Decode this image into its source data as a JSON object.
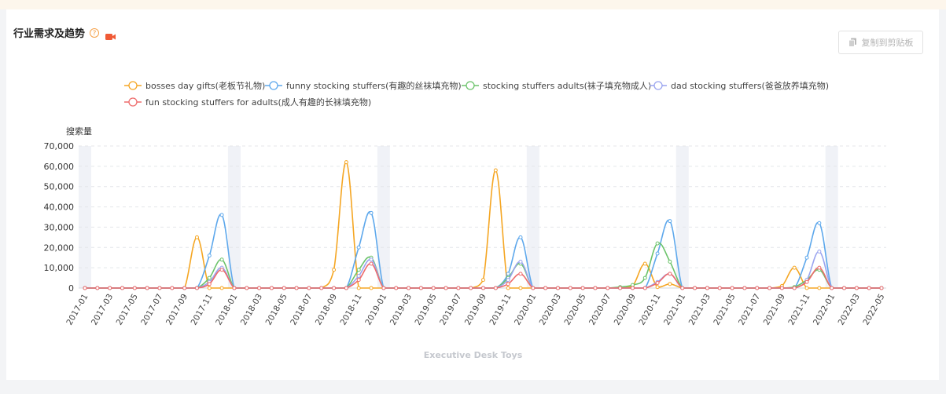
{
  "header": {
    "title": "行业需求及趋势",
    "help_glyph": "?",
    "copy_label": "复制到剪贴板"
  },
  "colors": {
    "accent": "#f08a3a",
    "video_icon": "#f05a36"
  },
  "chart_data": {
    "type": "line",
    "ylabel": "搜索量",
    "xlabel": "",
    "ylim": [
      0,
      70000
    ],
    "yticks": [
      "0",
      "10,000",
      "20,000",
      "30,000",
      "40,000",
      "50,000",
      "60,000",
      "70,000"
    ],
    "x": [
      "2017-01",
      "2017-02",
      "2017-03",
      "2017-04",
      "2017-05",
      "2017-06",
      "2017-07",
      "2017-08",
      "2017-09",
      "2017-10",
      "2017-11",
      "2017-12",
      "2018-01",
      "2018-02",
      "2018-03",
      "2018-04",
      "2018-05",
      "2018-06",
      "2018-07",
      "2018-08",
      "2018-09",
      "2018-10",
      "2018-11",
      "2018-12",
      "2019-01",
      "2019-02",
      "2019-03",
      "2019-04",
      "2019-05",
      "2019-06",
      "2019-07",
      "2019-08",
      "2019-09",
      "2019-10",
      "2019-11",
      "2019-12",
      "2020-01",
      "2020-02",
      "2020-03",
      "2020-04",
      "2020-05",
      "2020-06",
      "2020-07",
      "2020-08",
      "2020-09",
      "2020-10",
      "2020-11",
      "2020-12",
      "2021-01",
      "2021-02",
      "2021-03",
      "2021-04",
      "2021-05",
      "2021-06",
      "2021-07",
      "2021-08",
      "2021-09",
      "2021-10",
      "2021-11",
      "2021-12",
      "2022-01",
      "2022-02",
      "2022-03",
      "2022-04",
      "2022-05"
    ],
    "xticks": [
      "2017-01",
      "2017-03",
      "2017-05",
      "2017-07",
      "2017-09",
      "2017-11",
      "2018-01",
      "2018-03",
      "2018-05",
      "2018-07",
      "2018-09",
      "2018-11",
      "2019-01",
      "2019-03",
      "2019-05",
      "2019-07",
      "2019-09",
      "2019-11",
      "2020-01",
      "2020-03",
      "2020-05",
      "2020-07",
      "2020-09",
      "2020-11",
      "2021-01",
      "2021-03",
      "2021-05",
      "2021-07",
      "2021-09",
      "2021-11",
      "2022-01",
      "2022-03",
      "2022-05"
    ],
    "series": [
      {
        "name": "bosses day gifts(老板节礼物)",
        "color": "#f5a623",
        "values": [
          0,
          0,
          0,
          0,
          0,
          0,
          0,
          0,
          0,
          25000,
          0,
          0,
          0,
          0,
          0,
          0,
          0,
          0,
          0,
          0,
          9000,
          62000,
          0,
          0,
          0,
          0,
          0,
          0,
          0,
          0,
          0,
          0,
          4000,
          58000,
          0,
          0,
          0,
          0,
          0,
          0,
          0,
          0,
          0,
          0,
          1000,
          12000,
          500,
          2000,
          0,
          0,
          0,
          0,
          0,
          0,
          0,
          0,
          1000,
          10000,
          0,
          0,
          0,
          0,
          0,
          0,
          0
        ]
      },
      {
        "name": "funny stocking stuffers(有趣的丝袜填充物)",
        "color": "#5ea8ec",
        "values": [
          0,
          0,
          0,
          0,
          0,
          0,
          0,
          0,
          0,
          0,
          16000,
          36000,
          0,
          0,
          0,
          0,
          0,
          0,
          0,
          0,
          0,
          0,
          20000,
          37000,
          0,
          0,
          0,
          0,
          0,
          0,
          0,
          0,
          0,
          0,
          7000,
          25000,
          0,
          0,
          0,
          0,
          0,
          0,
          0,
          0,
          0,
          0,
          17000,
          33000,
          0,
          0,
          0,
          0,
          0,
          0,
          0,
          0,
          0,
          0,
          15000,
          32000,
          0,
          0,
          0,
          0,
          0
        ]
      },
      {
        "name": "stocking stuffers adults(袜子填充物成人)",
        "color": "#6cc36b",
        "values": [
          0,
          0,
          0,
          0,
          0,
          0,
          0,
          0,
          0,
          0,
          5000,
          14000,
          0,
          0,
          0,
          0,
          0,
          0,
          0,
          0,
          0,
          0,
          9000,
          15000,
          0,
          0,
          0,
          0,
          0,
          0,
          0,
          0,
          0,
          0,
          5000,
          12000,
          0,
          0,
          0,
          0,
          0,
          0,
          0,
          500,
          1500,
          5000,
          22000,
          13000,
          0,
          0,
          0,
          0,
          0,
          0,
          0,
          0,
          0,
          500,
          4000,
          9000,
          0,
          0,
          0,
          0,
          0
        ]
      },
      {
        "name": "dad stocking stuffers(爸爸放养填充物)",
        "color": "#9aa4ef",
        "values": [
          0,
          0,
          0,
          0,
          0,
          0,
          0,
          0,
          0,
          0,
          3000,
          10000,
          0,
          0,
          0,
          0,
          0,
          0,
          0,
          0,
          0,
          0,
          6000,
          14000,
          0,
          0,
          0,
          0,
          0,
          0,
          0,
          0,
          0,
          0,
          4000,
          13000,
          0,
          0,
          0,
          0,
          0,
          0,
          0,
          0,
          0,
          0,
          3000,
          7000,
          0,
          0,
          0,
          0,
          0,
          0,
          0,
          0,
          0,
          0,
          4000,
          18000,
          0,
          0,
          0,
          0,
          0
        ]
      },
      {
        "name": "fun stocking stuffers for adults(成人有趣的长袜填充物)",
        "color": "#ee6b6b",
        "values": [
          0,
          0,
          0,
          0,
          0,
          0,
          0,
          0,
          0,
          0,
          2000,
          9000,
          0,
          0,
          0,
          0,
          0,
          0,
          0,
          0,
          0,
          0,
          4000,
          12000,
          0,
          0,
          0,
          0,
          0,
          0,
          0,
          0,
          0,
          0,
          2000,
          7000,
          0,
          0,
          0,
          0,
          0,
          0,
          0,
          0,
          0,
          0,
          2500,
          7000,
          0,
          0,
          0,
          0,
          0,
          0,
          0,
          0,
          0,
          0,
          3000,
          10000,
          0,
          0,
          0,
          0,
          0
        ]
      }
    ],
    "grid": true,
    "legend_position": "top-center",
    "watermark": "Executive Desk Toys"
  }
}
